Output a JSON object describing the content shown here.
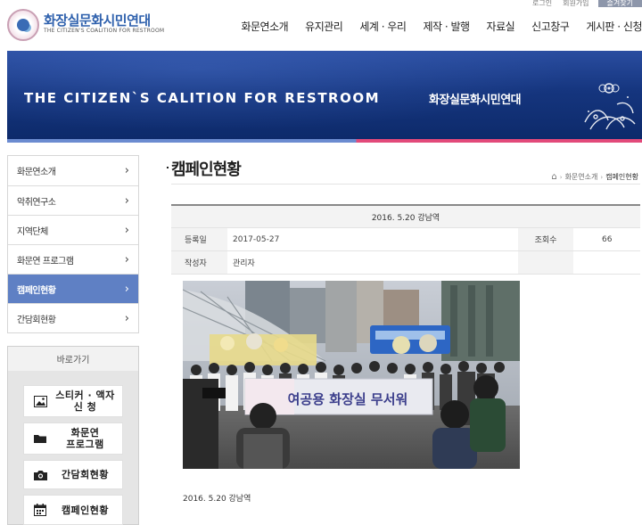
{
  "util": {
    "login": "로그인",
    "join": "회원가입",
    "extra": "즐겨찾기"
  },
  "brand": {
    "name_ko": "화장실문화시민연대",
    "name_en": "THE CITIZEN'S COALITION FOR RESTROOM"
  },
  "gnb": [
    "화문연소개",
    "유지관리",
    "세계 · 우리",
    "제작 · 발행",
    "자료실",
    "신고창구",
    "게시판 · 신청"
  ],
  "banner": {
    "en": "THE CITIZEN`S CALITION FOR RESTROOM",
    "ko": "화장실문화시민연대"
  },
  "sidebar": {
    "items": [
      {
        "label": "화문연소개",
        "active": false
      },
      {
        "label": "악취연구소",
        "active": false
      },
      {
        "label": "지역단체",
        "active": false
      },
      {
        "label": "화문연 프로그램",
        "active": false
      },
      {
        "label": "캠페인현황",
        "active": true
      },
      {
        "label": "간담회현황",
        "active": false
      }
    ],
    "arrow": "›"
  },
  "quick": {
    "title": "바로가기",
    "buttons": [
      {
        "label_line1": "스티커 · 액자",
        "label_line2": "신 청",
        "icon": "image-icon"
      },
      {
        "label_line1": "화문연",
        "label_line2": "프로그램",
        "icon": "folder-icon"
      },
      {
        "label_line1": "간담회현황",
        "label_line2": "",
        "icon": "camera-icon"
      },
      {
        "label_line1": "캠페인현황",
        "label_line2": "",
        "icon": "calendar-icon"
      }
    ]
  },
  "page": {
    "title": "캠페인현황"
  },
  "breadcrumb": [
    "화문연소개",
    "캠페인현황"
  ],
  "post": {
    "title": "2016. 5.20 강남역",
    "date_label": "등록일",
    "date": "2017-05-27",
    "views_label": "조회수",
    "views": "66",
    "author_label": "작성자",
    "author": "관리자",
    "banner_text": "여공용 화장실 무서워",
    "caption": "2016. 5.20 강남역"
  },
  "colors": {
    "accent": "#5f80c4",
    "banner": "#15357e",
    "pink": "#e24a7a"
  }
}
